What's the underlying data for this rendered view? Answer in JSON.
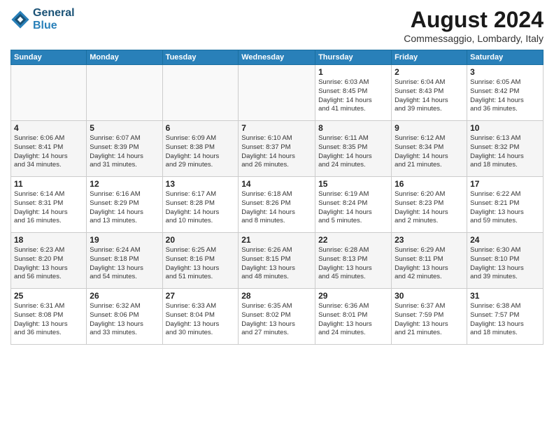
{
  "header": {
    "logo_line1": "General",
    "logo_line2": "Blue",
    "month": "August 2024",
    "location": "Commessaggio, Lombardy, Italy"
  },
  "weekdays": [
    "Sunday",
    "Monday",
    "Tuesday",
    "Wednesday",
    "Thursday",
    "Friday",
    "Saturday"
  ],
  "weeks": [
    [
      {
        "day": "",
        "info": ""
      },
      {
        "day": "",
        "info": ""
      },
      {
        "day": "",
        "info": ""
      },
      {
        "day": "",
        "info": ""
      },
      {
        "day": "1",
        "info": "Sunrise: 6:03 AM\nSunset: 8:45 PM\nDaylight: 14 hours\nand 41 minutes."
      },
      {
        "day": "2",
        "info": "Sunrise: 6:04 AM\nSunset: 8:43 PM\nDaylight: 14 hours\nand 39 minutes."
      },
      {
        "day": "3",
        "info": "Sunrise: 6:05 AM\nSunset: 8:42 PM\nDaylight: 14 hours\nand 36 minutes."
      }
    ],
    [
      {
        "day": "4",
        "info": "Sunrise: 6:06 AM\nSunset: 8:41 PM\nDaylight: 14 hours\nand 34 minutes."
      },
      {
        "day": "5",
        "info": "Sunrise: 6:07 AM\nSunset: 8:39 PM\nDaylight: 14 hours\nand 31 minutes."
      },
      {
        "day": "6",
        "info": "Sunrise: 6:09 AM\nSunset: 8:38 PM\nDaylight: 14 hours\nand 29 minutes."
      },
      {
        "day": "7",
        "info": "Sunrise: 6:10 AM\nSunset: 8:37 PM\nDaylight: 14 hours\nand 26 minutes."
      },
      {
        "day": "8",
        "info": "Sunrise: 6:11 AM\nSunset: 8:35 PM\nDaylight: 14 hours\nand 24 minutes."
      },
      {
        "day": "9",
        "info": "Sunrise: 6:12 AM\nSunset: 8:34 PM\nDaylight: 14 hours\nand 21 minutes."
      },
      {
        "day": "10",
        "info": "Sunrise: 6:13 AM\nSunset: 8:32 PM\nDaylight: 14 hours\nand 18 minutes."
      }
    ],
    [
      {
        "day": "11",
        "info": "Sunrise: 6:14 AM\nSunset: 8:31 PM\nDaylight: 14 hours\nand 16 minutes."
      },
      {
        "day": "12",
        "info": "Sunrise: 6:16 AM\nSunset: 8:29 PM\nDaylight: 14 hours\nand 13 minutes."
      },
      {
        "day": "13",
        "info": "Sunrise: 6:17 AM\nSunset: 8:28 PM\nDaylight: 14 hours\nand 10 minutes."
      },
      {
        "day": "14",
        "info": "Sunrise: 6:18 AM\nSunset: 8:26 PM\nDaylight: 14 hours\nand 8 minutes."
      },
      {
        "day": "15",
        "info": "Sunrise: 6:19 AM\nSunset: 8:24 PM\nDaylight: 14 hours\nand 5 minutes."
      },
      {
        "day": "16",
        "info": "Sunrise: 6:20 AM\nSunset: 8:23 PM\nDaylight: 14 hours\nand 2 minutes."
      },
      {
        "day": "17",
        "info": "Sunrise: 6:22 AM\nSunset: 8:21 PM\nDaylight: 13 hours\nand 59 minutes."
      }
    ],
    [
      {
        "day": "18",
        "info": "Sunrise: 6:23 AM\nSunset: 8:20 PM\nDaylight: 13 hours\nand 56 minutes."
      },
      {
        "day": "19",
        "info": "Sunrise: 6:24 AM\nSunset: 8:18 PM\nDaylight: 13 hours\nand 54 minutes."
      },
      {
        "day": "20",
        "info": "Sunrise: 6:25 AM\nSunset: 8:16 PM\nDaylight: 13 hours\nand 51 minutes."
      },
      {
        "day": "21",
        "info": "Sunrise: 6:26 AM\nSunset: 8:15 PM\nDaylight: 13 hours\nand 48 minutes."
      },
      {
        "day": "22",
        "info": "Sunrise: 6:28 AM\nSunset: 8:13 PM\nDaylight: 13 hours\nand 45 minutes."
      },
      {
        "day": "23",
        "info": "Sunrise: 6:29 AM\nSunset: 8:11 PM\nDaylight: 13 hours\nand 42 minutes."
      },
      {
        "day": "24",
        "info": "Sunrise: 6:30 AM\nSunset: 8:10 PM\nDaylight: 13 hours\nand 39 minutes."
      }
    ],
    [
      {
        "day": "25",
        "info": "Sunrise: 6:31 AM\nSunset: 8:08 PM\nDaylight: 13 hours\nand 36 minutes."
      },
      {
        "day": "26",
        "info": "Sunrise: 6:32 AM\nSunset: 8:06 PM\nDaylight: 13 hours\nand 33 minutes."
      },
      {
        "day": "27",
        "info": "Sunrise: 6:33 AM\nSunset: 8:04 PM\nDaylight: 13 hours\nand 30 minutes."
      },
      {
        "day": "28",
        "info": "Sunrise: 6:35 AM\nSunset: 8:02 PM\nDaylight: 13 hours\nand 27 minutes."
      },
      {
        "day": "29",
        "info": "Sunrise: 6:36 AM\nSunset: 8:01 PM\nDaylight: 13 hours\nand 24 minutes."
      },
      {
        "day": "30",
        "info": "Sunrise: 6:37 AM\nSunset: 7:59 PM\nDaylight: 13 hours\nand 21 minutes."
      },
      {
        "day": "31",
        "info": "Sunrise: 6:38 AM\nSunset: 7:57 PM\nDaylight: 13 hours\nand 18 minutes."
      }
    ]
  ]
}
